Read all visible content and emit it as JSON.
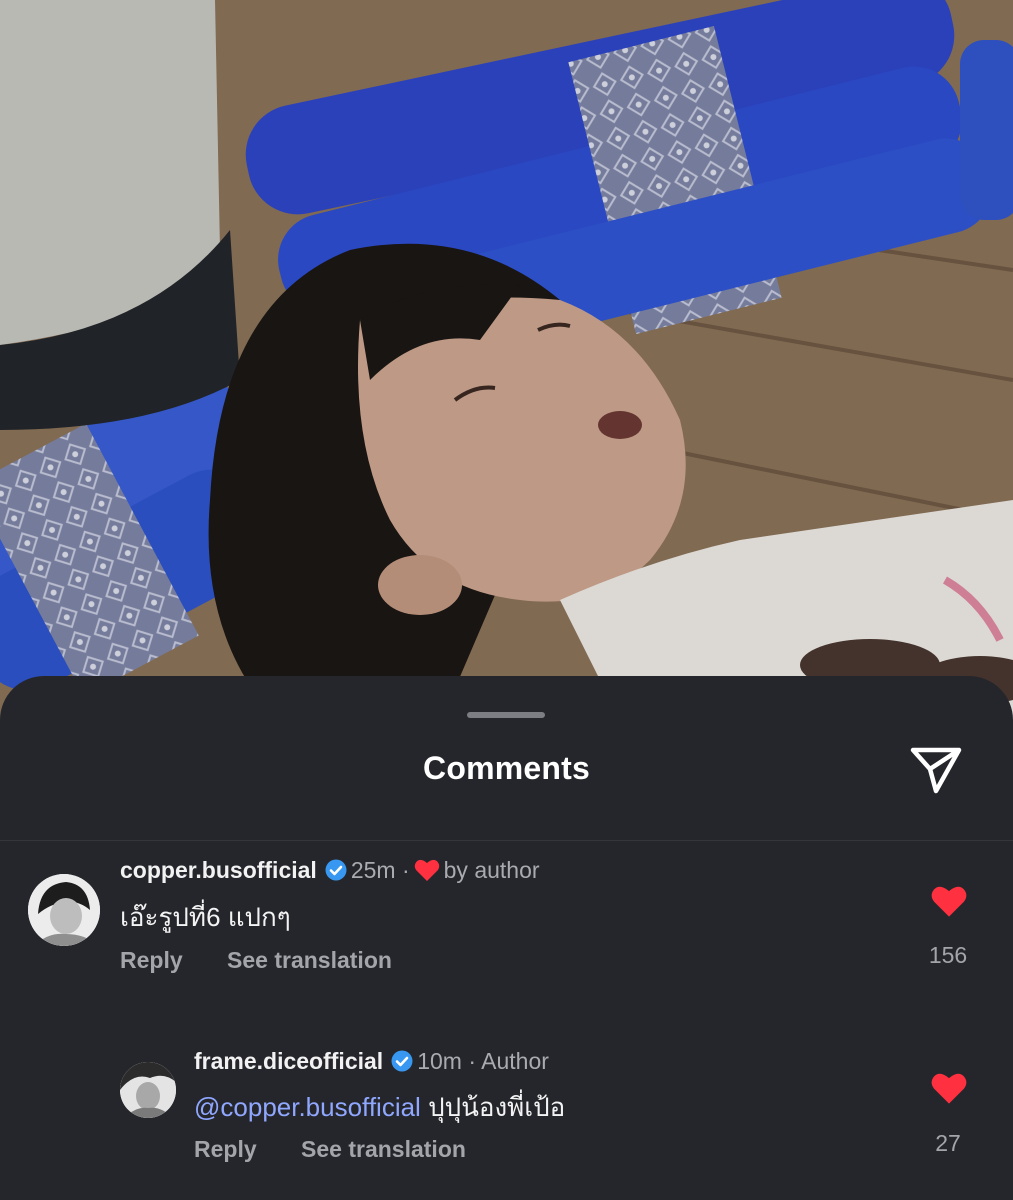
{
  "sheet": {
    "title": "Comments",
    "share_icon": "send-icon"
  },
  "comments": [
    {
      "username": "copper.busofficial",
      "verified": true,
      "time": "25m",
      "separator": "·",
      "badge": "by author",
      "text": "เอ๊ะรูปที่6 แปกๆ",
      "reply_label": "Reply",
      "translate_label": "See translation",
      "likes": "156"
    },
    {
      "username": "frame.diceofficial",
      "verified": true,
      "time": "10m",
      "separator": "·",
      "badge": "Author",
      "mention": "@copper.busofficial",
      "text": "ปุปุน้องพี่เป้อ",
      "reply_label": "Reply",
      "translate_label": "See translation",
      "likes": "27"
    }
  ],
  "colors": {
    "sheet_background": "#25262b",
    "heart_red": "#ff3040",
    "verified_blue": "#3897f0",
    "mention_blue": "#8fa7ff"
  }
}
